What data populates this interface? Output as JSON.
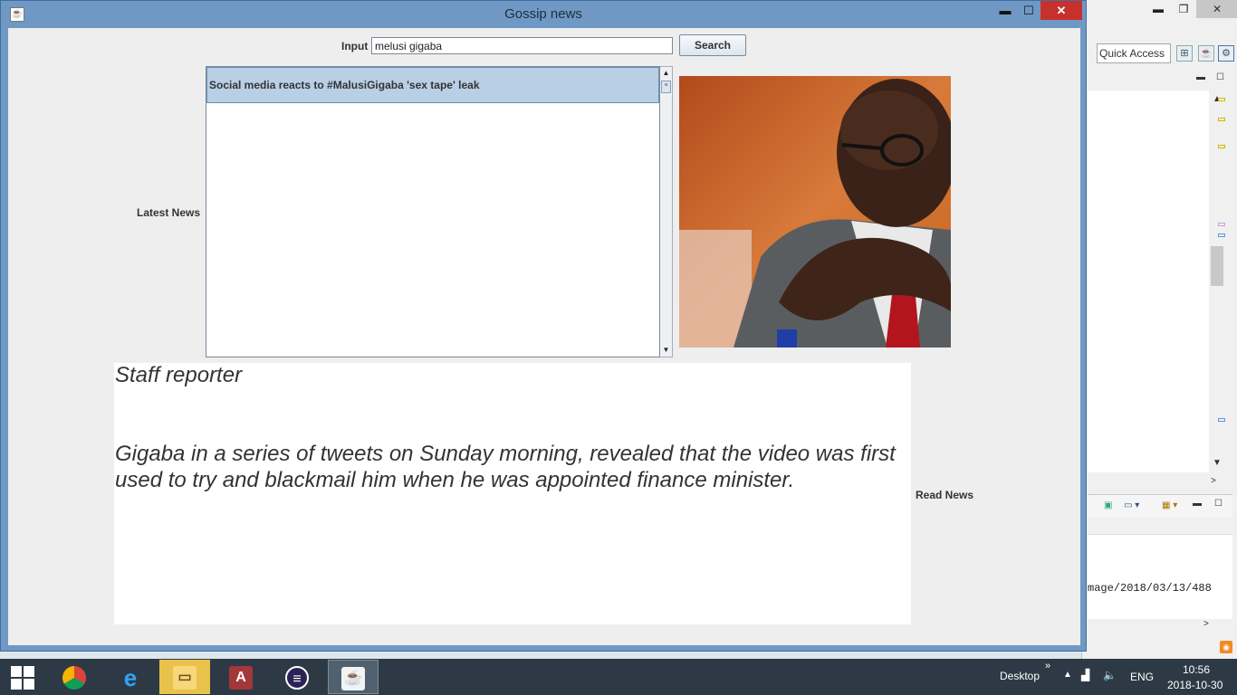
{
  "window": {
    "title": "Gossip news",
    "controls": {
      "minimize": "▬",
      "maximize": "☐",
      "close": "✕"
    }
  },
  "search": {
    "label": "Input",
    "value": "melusi gigaba",
    "button": "Search"
  },
  "news": {
    "label": "Latest News",
    "items": [
      {
        "title": "Social media reacts to #MalusiGigaba 'sex tape' leak",
        "selected": true
      }
    ]
  },
  "article": {
    "author": "Staff reporter",
    "body": "Gigaba in a series of tweets on Sunday morning, revealed that the video was first used to try and blackmail him when he was appointed finance minister.",
    "read_label": "Read News"
  },
  "ide": {
    "quick_access": "Quick Access",
    "console_text": "mage/2018/03/13/488"
  },
  "taskbar": {
    "apps": [
      "chrome-icon",
      "ie-icon",
      "file-explorer-icon",
      "access-icon",
      "eclipse-icon",
      "java-icon"
    ],
    "desktop_label": "Desktop",
    "language": "ENG",
    "time": "10:56",
    "date": "2018-10-30",
    "colors": {
      "taskbar": "#2d3a46",
      "titlebar": "#6f99c4",
      "close": "#c7312b"
    }
  }
}
